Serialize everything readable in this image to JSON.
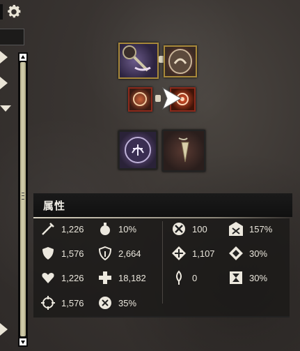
{
  "panel": {
    "title": "属性"
  },
  "icons": {
    "settings": "gear-icon",
    "slots": [
      "weapon-mace-icon",
      "weapon-shield-icon",
      "sigil-icon",
      "sigil-icon",
      "accessory-rune-icon",
      "amulet-fang-icon"
    ]
  },
  "stats": {
    "power": "1,226",
    "toughness": "1,576",
    "vitality": "1,226",
    "precision": "1,576",
    "crit_chance": "10%",
    "armor": "2,664",
    "health": "18,182",
    "crit_damage": "35%",
    "ferocity": "100",
    "condition_damage": "1,107",
    "magic_find": "0",
    "boon_duration": "157%",
    "condition_duration": "30%",
    "healing_power": "30%"
  },
  "colors": {
    "gold_border": "#a8893a",
    "red_border": "#8b2a1c",
    "scroll_thumb": "#d4cfae"
  }
}
